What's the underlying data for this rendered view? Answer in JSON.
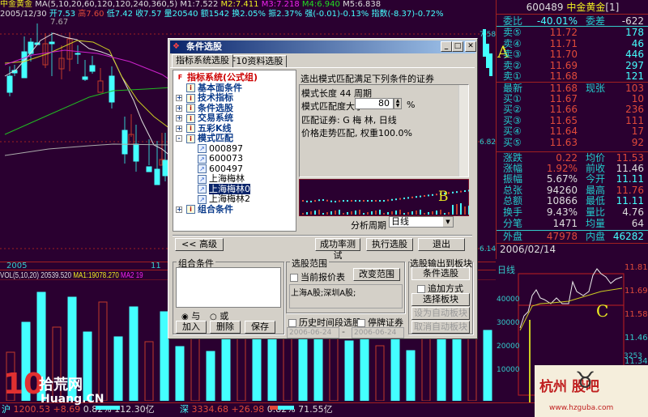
{
  "header": {
    "stock_name": "中金黄金",
    "ma_params": "MA(5,10,20,60,120,120,240,360,5)",
    "ma1": "M1:7.522",
    "ma2": "M2:7.411",
    "ma3": "M3:7.218",
    "ma4": "M4:6.940",
    "ma5": "M5:6.838",
    "date": "2005/12/30",
    "open": "开7.53",
    "high": "高7.60",
    "low": "低7.42",
    "close": "收7.57",
    "volume": "量20540",
    "amount": "额1542",
    "turnover": "换2.05%",
    "amplitude": "振2.37%",
    "strength": "强(-0.01)-0.13%",
    "index": "指数(-8.37)-0.72%",
    "peak_label": "7.67"
  },
  "price_axis": [
    "7.58",
    "6.82",
    "6.14"
  ],
  "date_axis": [
    "2005",
    "11"
  ],
  "volume_header": {
    "label": "VOL(5,10,20)",
    "value": "20539.520",
    "ma1": "MA1:19078.270",
    "ma2": "MA2 19"
  },
  "annotations": {
    "a": "A",
    "b": "B",
    "c": "C"
  },
  "quote": {
    "code": "600489",
    "name": "中金黄金",
    "suffix": "[1]",
    "weibi_label": "委比",
    "weibi": "-40.01%",
    "weicha_label": "委差",
    "weicha": "-622",
    "sells": [
      {
        "label": "卖⑤",
        "price": "11.72",
        "vol": "178"
      },
      {
        "label": "卖④",
        "price": "11.71",
        "vol": "46"
      },
      {
        "label": "卖③",
        "price": "11.70",
        "vol": "446"
      },
      {
        "label": "卖②",
        "price": "11.69",
        "vol": "297"
      },
      {
        "label": "卖①",
        "price": "11.68",
        "vol": "121"
      }
    ],
    "latest": {
      "label": "最新",
      "price": "11.68",
      "label2": "现张",
      "vol": "103"
    },
    "buys": [
      {
        "label": "买①",
        "price": "11.67",
        "vol": "10"
      },
      {
        "label": "买②",
        "price": "11.66",
        "vol": "236"
      },
      {
        "label": "买③",
        "price": "11.65",
        "vol": "111"
      },
      {
        "label": "买④",
        "price": "11.64",
        "vol": "17"
      },
      {
        "label": "买⑤",
        "price": "11.63",
        "vol": "92"
      }
    ],
    "stats": [
      {
        "l1": "涨跌",
        "v1": "0.22",
        "l2": "均价",
        "v2": "11.53"
      },
      {
        "l1": "涨幅",
        "v1": "1.92%",
        "l2": "前收",
        "v2": "11.46"
      },
      {
        "l1": "振幅",
        "v1": "5.67%",
        "l2": "今开",
        "v2": "11.11"
      },
      {
        "l1": "总张",
        "v1": "94260",
        "l2": "最高",
        "v2": "11.76"
      },
      {
        "l1": "总额",
        "v1": "10866",
        "l2": "最低",
        "v2": "11.11"
      },
      {
        "l1": "换手",
        "v1": "9.43%",
        "l2": "量比",
        "v2": "4.76"
      },
      {
        "l1": "分笔",
        "v1": "1471",
        "l2": "均量",
        "v2": "64"
      }
    ],
    "outer_label": "外盘",
    "outer": "47978",
    "inner_label": "内盘",
    "inner": "46282",
    "date": "2006/02/14"
  },
  "intraday": {
    "period": "日线",
    "price_ticks": [
      "11.81",
      "11.69",
      "11.58",
      "11.46",
      "11.34",
      "11.23"
    ],
    "vol_ticks": [
      "40000",
      "30000",
      "20000",
      "10000"
    ],
    "vol_max": "3253",
    "detail": "细"
  },
  "dialog": {
    "title": "条件选股",
    "tabs": [
      "指标系统选股",
      "F10资料选股"
    ],
    "tree": [
      {
        "label": "指标系统(公式组)",
        "level": 0,
        "bold": true,
        "red": true
      },
      {
        "label": "基本面条件",
        "level": 1,
        "bold": true
      },
      {
        "label": "技术指标",
        "level": 1,
        "bold": true,
        "expander": "+"
      },
      {
        "label": "条件选股",
        "level": 1,
        "bold": true,
        "expander": "+"
      },
      {
        "label": "交易系统",
        "level": 1,
        "bold": true,
        "expander": "+"
      },
      {
        "label": "五彩K线",
        "level": 1,
        "bold": true,
        "expander": "+"
      },
      {
        "label": "模式匹配",
        "level": 1,
        "bold": true,
        "expander": "-"
      },
      {
        "label": "000897",
        "level": 2
      },
      {
        "label": "600073",
        "level": 2
      },
      {
        "label": "600497",
        "level": 2
      },
      {
        "label": "上海梅林",
        "level": 2
      },
      {
        "label": "上海梅林0",
        "level": 2,
        "selected": true
      },
      {
        "label": "上海梅林2",
        "level": 2
      },
      {
        "label": "组合条件",
        "level": 1,
        "bold": true,
        "expander": "+"
      }
    ],
    "desc_title": "选出模式匹配满足下列条件的证券",
    "pattern_length": "模式长度 44 周期",
    "match_label": "模式匹配度大于",
    "match_value": "80",
    "match_unit": "%",
    "match_stock": "匹配证券: G 梅  林, 日线",
    "weight": "价格走势匹配, 权重100.0%",
    "period_label": "分析周期",
    "period_value": "日线",
    "buttons": {
      "advanced": "<< 高级",
      "test": "成功率测试",
      "execute": "执行选股",
      "exit": "退出"
    },
    "combo": {
      "title": "组合条件",
      "and": "与",
      "or": "或",
      "add": "加入",
      "delete": "删除",
      "save": "保存"
    },
    "range": {
      "title": "选股范围",
      "current_quote": "当前报价表",
      "change": "改变范围",
      "markets": "上海A股;深圳A股;",
      "history": "历史时间段选股",
      "suspended": "停牌证券",
      "date_from": "2006-06-24",
      "date_to": "2006-06-24",
      "dash": "-"
    },
    "output": {
      "title": "选股输出到板块",
      "block": "条件选股",
      "append": "追加方式",
      "choose": "选择板块",
      "set_auto": "设为自动板块",
      "cancel_auto": "取消自动板块"
    }
  },
  "status": {
    "sh": "沪",
    "sh_value": "1200.53",
    "sh_change": "+8.69",
    "sh_pct": "0.82%",
    "sh_amount": "112.30亿",
    "sz": "深",
    "sz_value": "3334.68",
    "sz_change": "+26.98",
    "sz_pct": "0.82%",
    "sz_amount": "71.55亿"
  },
  "watermarks": {
    "left": "10拾荒网",
    "left_url": "Huang.CN",
    "right": "杭州 股吧",
    "right_url": "www.hzguba.com"
  },
  "colors": {
    "bg": "#2a0030",
    "up": "#e04a3a",
    "down": "#4ff",
    "grid": "#a02020",
    "dialog": "#d4d0c8"
  }
}
